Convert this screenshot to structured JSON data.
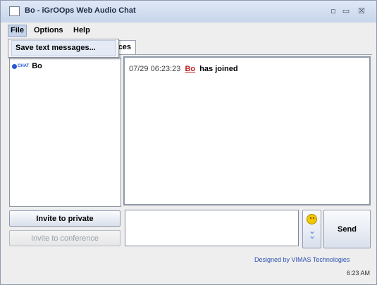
{
  "window": {
    "title": "Bo - iGrOOps Web Audio Chat",
    "buttons": [
      "minimize-icon",
      "maximize-icon",
      "close-icon"
    ]
  },
  "menubar": {
    "items": [
      "File",
      "Options",
      "Help"
    ],
    "active": "File"
  },
  "file_menu": {
    "items": [
      "Save text messages..."
    ]
  },
  "tabs": {
    "visible_fragment": "ces"
  },
  "userlist": {
    "users": [
      {
        "status_tag": "CHAT",
        "name": "Bo"
      }
    ]
  },
  "chat": {
    "messages": [
      {
        "time": "07/29 06:23:23",
        "user": "Bo",
        "text": "has joined"
      }
    ]
  },
  "actions": {
    "invite_private": "Invite to private",
    "invite_conference": "Invite to conference",
    "send": "Send",
    "emoticon_icon": "smiley-icon",
    "expand_icon": "double-chevron-down-icon"
  },
  "footer": {
    "credit": "Designed by VIMAS Technologies",
    "time": "6:23 AM"
  },
  "colors": {
    "titlebar": "#c7d5ea",
    "username": "#c02020",
    "credit_link": "#2a4fb0"
  }
}
